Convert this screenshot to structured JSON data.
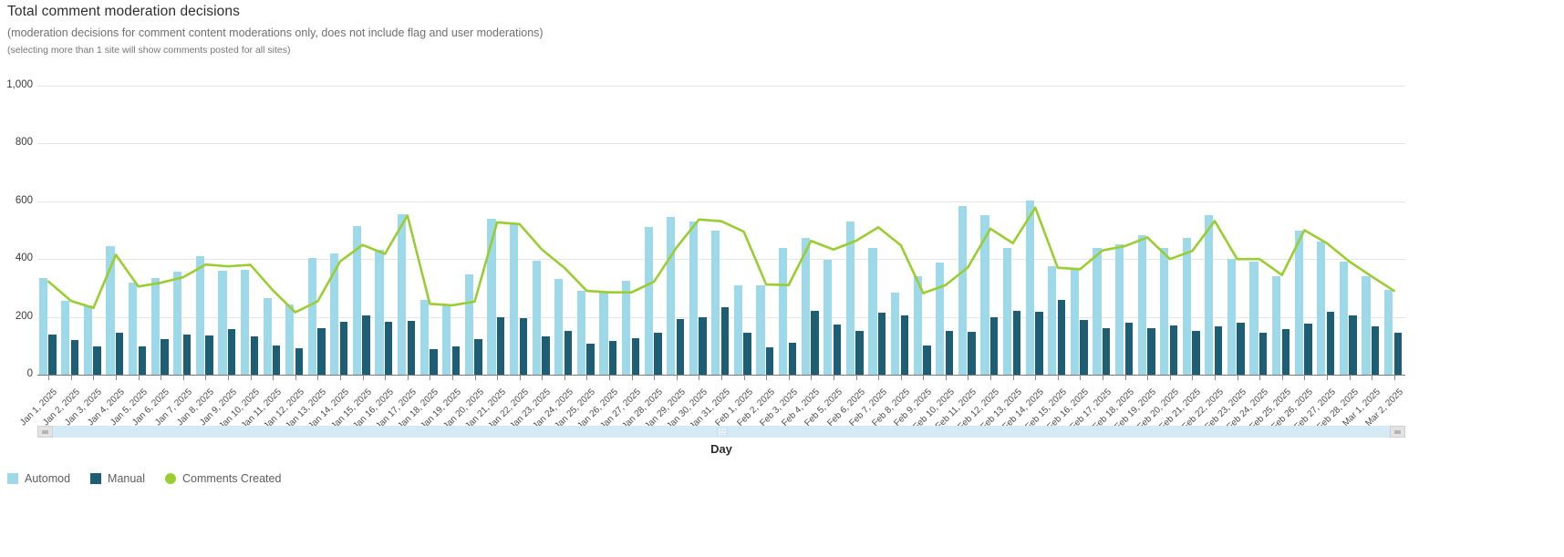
{
  "header": {
    "title": "Total comment moderation decisions",
    "subtitle": "(moderation decisions for comment content moderations only, does not include flag and user moderations)",
    "subtitle2": "(selecting more than 1 site will show comments posted for all sites)"
  },
  "axis": {
    "x_title": "Day",
    "y_ticks": [
      "0",
      "200",
      "400",
      "600",
      "800",
      "1,000"
    ]
  },
  "legend": [
    {
      "label": "Automod",
      "color": "#9ed9ea",
      "shape": "square"
    },
    {
      "label": "Manual",
      "color": "#1d5e75",
      "shape": "square"
    },
    {
      "label": "Comments Created",
      "color": "#9acd32",
      "shape": "circle"
    }
  ],
  "scrollbar": {
    "left_arrow": "scroll-left",
    "right_arrow": "scroll-right"
  },
  "colors": {
    "automod": "#9ed9ea",
    "manual": "#1d5e75",
    "comments_created": "#9acd32",
    "gridline": "#e4e4e4",
    "axis": "#7a7a7a"
  },
  "chart_data": {
    "type": "bar",
    "title": "Total comment moderation decisions",
    "subtitle": "(moderation decisions for comment content moderations only, does not include flag and user moderations)",
    "xlabel": "Day",
    "ylabel": "",
    "ylim": [
      0,
      1000
    ],
    "grid": true,
    "legend_position": "bottom-left",
    "categories": [
      "Jan 1, 2025",
      "Jan 2, 2025",
      "Jan 3, 2025",
      "Jan 4, 2025",
      "Jan 5, 2025",
      "Jan 6, 2025",
      "Jan 7, 2025",
      "Jan 8, 2025",
      "Jan 9, 2025",
      "Jan 10, 2025",
      "Jan 11, 2025",
      "Jan 12, 2025",
      "Jan 13, 2025",
      "Jan 14, 2025",
      "Jan 15, 2025",
      "Jan 16, 2025",
      "Jan 17, 2025",
      "Jan 18, 2025",
      "Jan 19, 2025",
      "Jan 20, 2025",
      "Jan 21, 2025",
      "Jan 22, 2025",
      "Jan 23, 2025",
      "Jan 24, 2025",
      "Jan 25, 2025",
      "Jan 26, 2025",
      "Jan 27, 2025",
      "Jan 28, 2025",
      "Jan 29, 2025",
      "Jan 30, 2025",
      "Jan 31, 2025",
      "Feb 1, 2025",
      "Feb 2, 2025",
      "Feb 3, 2025",
      "Feb 4, 2025",
      "Feb 5, 2025",
      "Feb 6, 2025",
      "Feb 7, 2025",
      "Feb 8, 2025",
      "Feb 9, 2025",
      "Feb 10, 2025",
      "Feb 11, 2025",
      "Feb 12, 2025",
      "Feb 13, 2025",
      "Feb 14, 2025",
      "Feb 15, 2025",
      "Feb 16, 2025",
      "Feb 17, 2025",
      "Feb 18, 2025",
      "Feb 19, 2025",
      "Feb 20, 2025",
      "Feb 21, 2025",
      "Feb 22, 2025",
      "Feb 23, 2025",
      "Feb 24, 2025",
      "Feb 25, 2025",
      "Feb 26, 2025",
      "Feb 27, 2025",
      "Feb 28, 2025",
      "Mar 1, 2025",
      "Mar 2, 2025"
    ],
    "series": [
      {
        "name": "Automod",
        "type": "bar",
        "color": "#9ed9ea",
        "values": [
          335,
          255,
          240,
          445,
          320,
          335,
          355,
          410,
          360,
          362,
          265,
          243,
          405,
          420,
          513,
          432,
          556,
          258,
          243,
          348,
          540,
          522,
          395,
          330,
          291,
          285,
          326,
          511,
          545,
          530,
          500,
          310,
          308,
          438,
          472,
          398,
          530,
          440,
          283,
          340,
          388,
          585,
          551,
          440,
          601,
          374,
          370,
          440,
          452,
          482,
          440,
          472,
          553,
          400,
          390,
          340,
          500,
          460,
          392,
          340,
          295
        ]
      },
      {
        "name": "Manual",
        "type": "bar",
        "color": "#1d5e75",
        "values": [
          139,
          120,
          99,
          145,
          99,
          122,
          138,
          137,
          157,
          132,
          100,
          92,
          160,
          183,
          205,
          182,
          187,
          89,
          99,
          124,
          198,
          197,
          133,
          152,
          106,
          118,
          125,
          145,
          192,
          200,
          232,
          145,
          94,
          111,
          220,
          172,
          150,
          215,
          205,
          101,
          153,
          147,
          198,
          220,
          219,
          258,
          190,
          162,
          181,
          160,
          170,
          153,
          166,
          179,
          146,
          158,
          176,
          219,
          205,
          167,
          146
        ]
      },
      {
        "name": "Comments Created",
        "type": "line",
        "color": "#9acd32",
        "values": [
          322,
          255,
          231,
          415,
          305,
          318,
          337,
          381,
          375,
          380,
          292,
          216,
          254,
          392,
          449,
          418,
          551,
          245,
          240,
          253,
          527,
          521,
          433,
          370,
          290,
          285,
          285,
          322,
          440,
          537,
          531,
          495,
          312,
          310,
          463,
          433,
          463,
          510,
          448,
          282,
          310,
          372,
          505,
          455,
          578,
          370,
          365,
          430,
          445,
          475,
          400,
          428,
          532,
          400,
          400,
          345,
          500,
          455,
          392,
          340,
          290
        ]
      }
    ]
  }
}
